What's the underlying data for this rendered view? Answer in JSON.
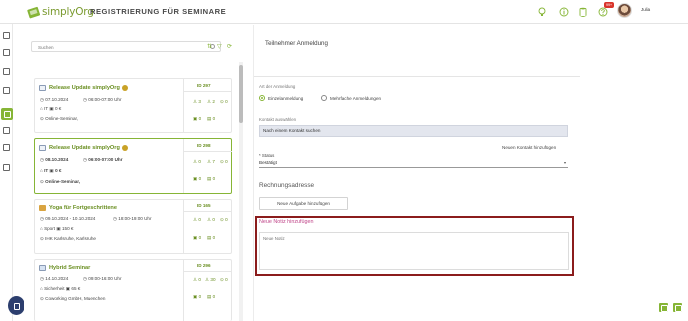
{
  "app": {
    "logo_text": "simplyOrg",
    "page_title": "REGISTRIERUNG FÜR SEMINARE",
    "notification_badge": "99+",
    "user_name": "Julia"
  },
  "search": {
    "placeholder": "Suchen"
  },
  "seminars": [
    {
      "title": "Release Update simplyOrg",
      "date": "07.10.2024",
      "time": "06:00-07:00 Uhr",
      "category": "IT",
      "price": "0 €",
      "location": "Online-Seminar,",
      "id_label": "ID 297",
      "stat_a": "3",
      "stat_b": "2",
      "stat_c": "0",
      "stat_d": "0",
      "stat_e": "0"
    },
    {
      "title": "Release Update simplyOrg",
      "date": "08.10.2024",
      "time": "06:00-07:00 Uhr",
      "category": "IT",
      "price": "0 €",
      "location": "Online-Seminar,",
      "id_label": "ID 298",
      "stat_a": "0",
      "stat_b": "7",
      "stat_c": "0",
      "stat_d": "0",
      "stat_e": "0"
    },
    {
      "title": "Yoga für Fortgeschrittene",
      "date": "09.10.2024 - 10.10.2024",
      "time": "18:00-19:00 Uhr",
      "category": "Sport",
      "price": "150 €",
      "location": "IHK Karlsruhe, Karlsruhe",
      "id_label": "ID 165",
      "stat_a": "0",
      "stat_b": "0",
      "stat_c": "0",
      "stat_d": "0",
      "stat_e": "0"
    },
    {
      "title": "Hybrid Seminar",
      "date": "14.10.2024",
      "time": "09:00-16:00 Uhr",
      "category": "Sicherheit",
      "price": "65 €",
      "location": "Coworking GmbH, Muenchen",
      "id_label": "ID 296",
      "stat_a": "0",
      "stat_b": "30",
      "stat_c": "0",
      "stat_d": "0",
      "stat_e": "0"
    }
  ],
  "form": {
    "title": "Teilnehmer Anmeldung",
    "registration_type_label": "Art der Anmeldung",
    "option_single": "Einzelanmeldung",
    "option_multi": "Mehrfache Anmeldungen",
    "contact_label": "Kontakt auswählen",
    "contact_value": "Nach einem Kontakt suchen",
    "new_contact_link": "Neuen Kontakt hinzufügen",
    "status_label": "* Status",
    "status_value": "Bestätigt",
    "billing_heading": "Rechnungsadresse",
    "add_task_button": "Neue Aufgabe hinzufügen",
    "note_heading": "Neue Notiz hinzufügen",
    "note_placeholder": "Neue Notiz"
  },
  "colors": {
    "accent": "#86b536",
    "highlight_border": "#8b1c1c",
    "note_heading": "#c0478a"
  }
}
